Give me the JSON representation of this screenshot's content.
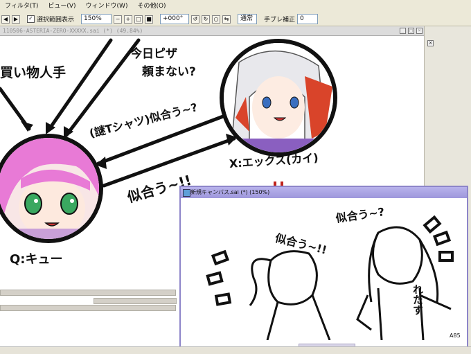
{
  "menubar": {
    "items": [
      "フィルタ(T)",
      "ビュー(V)",
      "ウィンドウ(W)",
      "その他(O)"
    ]
  },
  "toolbar": {
    "show_selection_label": "選択範囲表示",
    "zoom_value": "150%",
    "rotation_value": "+000°",
    "blend_mode": "通常",
    "stabilizer_label": "手ブレ補正",
    "stabilizer_value": "0"
  },
  "main_window": {
    "title": "110506-ASTERIA-ZERO-XXXXX.sai (*) (49.84%)"
  },
  "canvas_text": {
    "shopping": "買い物人手",
    "pizza_line1": "今日ピザ",
    "pizza_line2": "頼まない?",
    "shirt": "(謎Tシャツ)似合う~?",
    "suits": "似合う~!!",
    "x_name": "X:エックス(カイ)",
    "q_name": "Q:キュー"
  },
  "sub_window": {
    "title": "新規キャンバス.sai (*) (150%)",
    "text_suits": "似合う~!!",
    "text_suits_question": "似合う~?",
    "text_taken": "れたす",
    "signature": "A85"
  },
  "colors": {
    "chrome": "#ece9d8",
    "sub_window_border": "#8d85c9",
    "q_hair": "#e87ad6",
    "q_eyes": "#3aa860",
    "x_hair": "#e8e8ec",
    "x_accent": "#d9442a"
  }
}
